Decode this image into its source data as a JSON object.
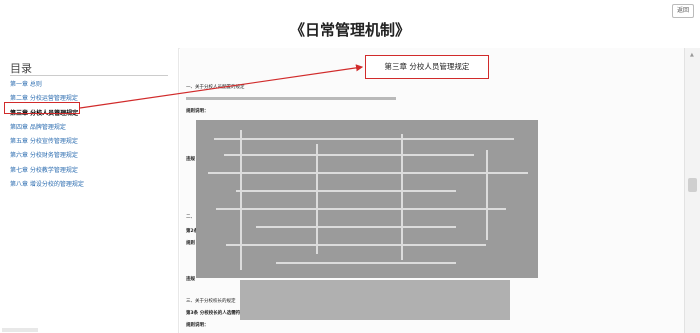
{
  "page": {
    "title": "《日常管理机制》",
    "back_label": "返回"
  },
  "toc": {
    "title": "目录",
    "items": [
      {
        "label": "第一章 总则"
      },
      {
        "label": "第二章 分校运营管理规定"
      },
      {
        "label": "第三章 分校人员管理规定",
        "active": true
      },
      {
        "label": "第四章 品牌管理规定"
      },
      {
        "label": "第五章 分校宣传管理规定"
      },
      {
        "label": "第六章 分校财务管理规定"
      },
      {
        "label": "第七章 分校教学管理规定"
      },
      {
        "label": "第八章 增设分校的管理规定"
      }
    ]
  },
  "content": {
    "chapter_header": "第三章 分校人员管理规定",
    "section1_title": "一、关于分校人员配置的规定",
    "rule_label_1": "规则说明：",
    "rule_label_2": "违规",
    "section2_title": "二、",
    "section2_sub": "第2条",
    "rule_label_3": "规则",
    "rule_label_4": "违规",
    "section3_title": "三、关于分校校长的规定",
    "section3_rule": "第3条 分校校长的人选需符合基本的任职条件",
    "rule_label_5": "规则说明："
  }
}
